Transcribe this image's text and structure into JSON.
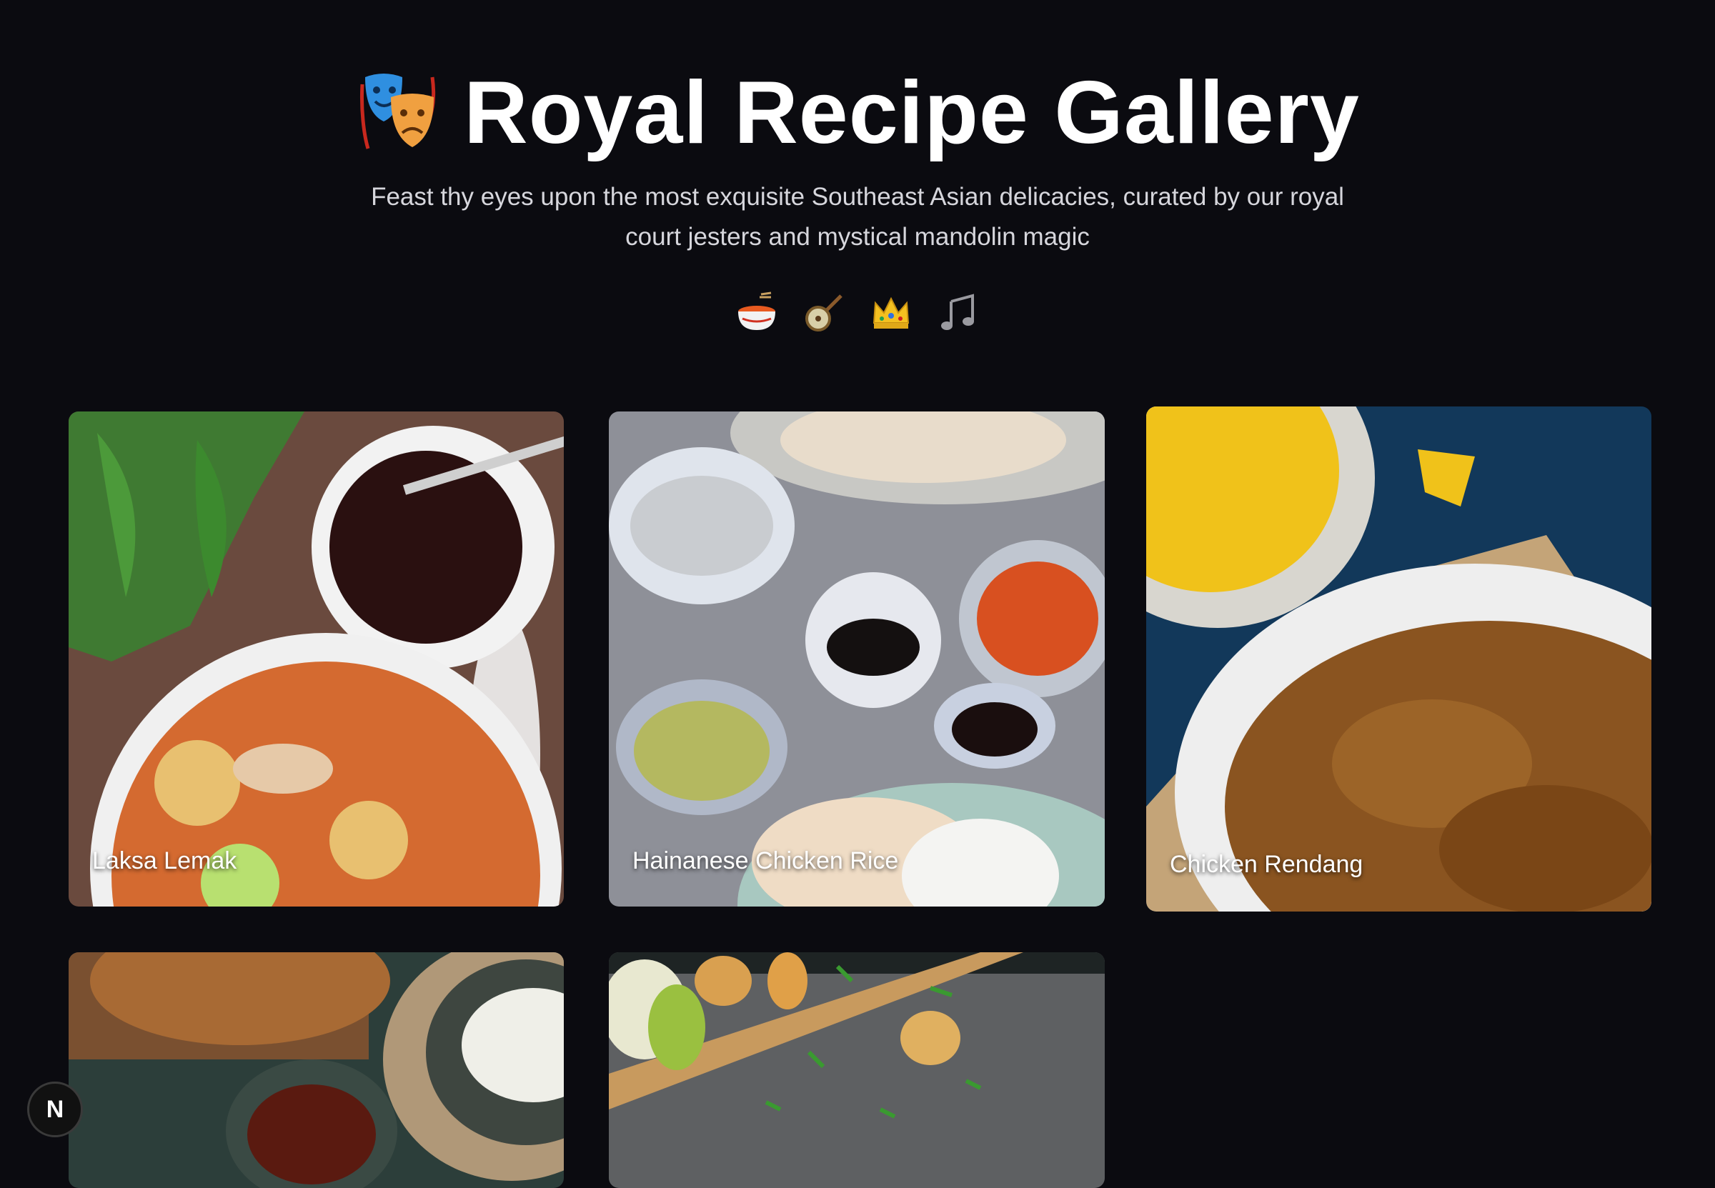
{
  "header": {
    "title": "Royal Recipe Gallery",
    "subtitle": "Feast thy eyes upon the most exquisite Southeast Asian delicacies, curated by our royal court jesters and mystical mandolin magic",
    "title_icon": "theater-masks-icon",
    "emojis": [
      "noodle-bowl-icon",
      "banjo-icon",
      "crown-icon",
      "music-notes-icon"
    ]
  },
  "gallery": {
    "cards": [
      {
        "label": "Laksa Lemak",
        "image": "laksa-photo"
      },
      {
        "label": "Hainanese Chicken Rice",
        "image": "chicken-rice-photo"
      },
      {
        "label": "Chicken Rendang",
        "image": "rendang-photo"
      },
      {
        "label": "",
        "image": "sambal-rice-photo"
      },
      {
        "label": "",
        "image": "tofu-board-photo"
      }
    ]
  },
  "badge": {
    "text": "N",
    "icon": "nextjs-icon"
  },
  "colors": {
    "background": "#0b0b10",
    "title": "#ffffff",
    "subtitle": "#d6d6dc"
  }
}
